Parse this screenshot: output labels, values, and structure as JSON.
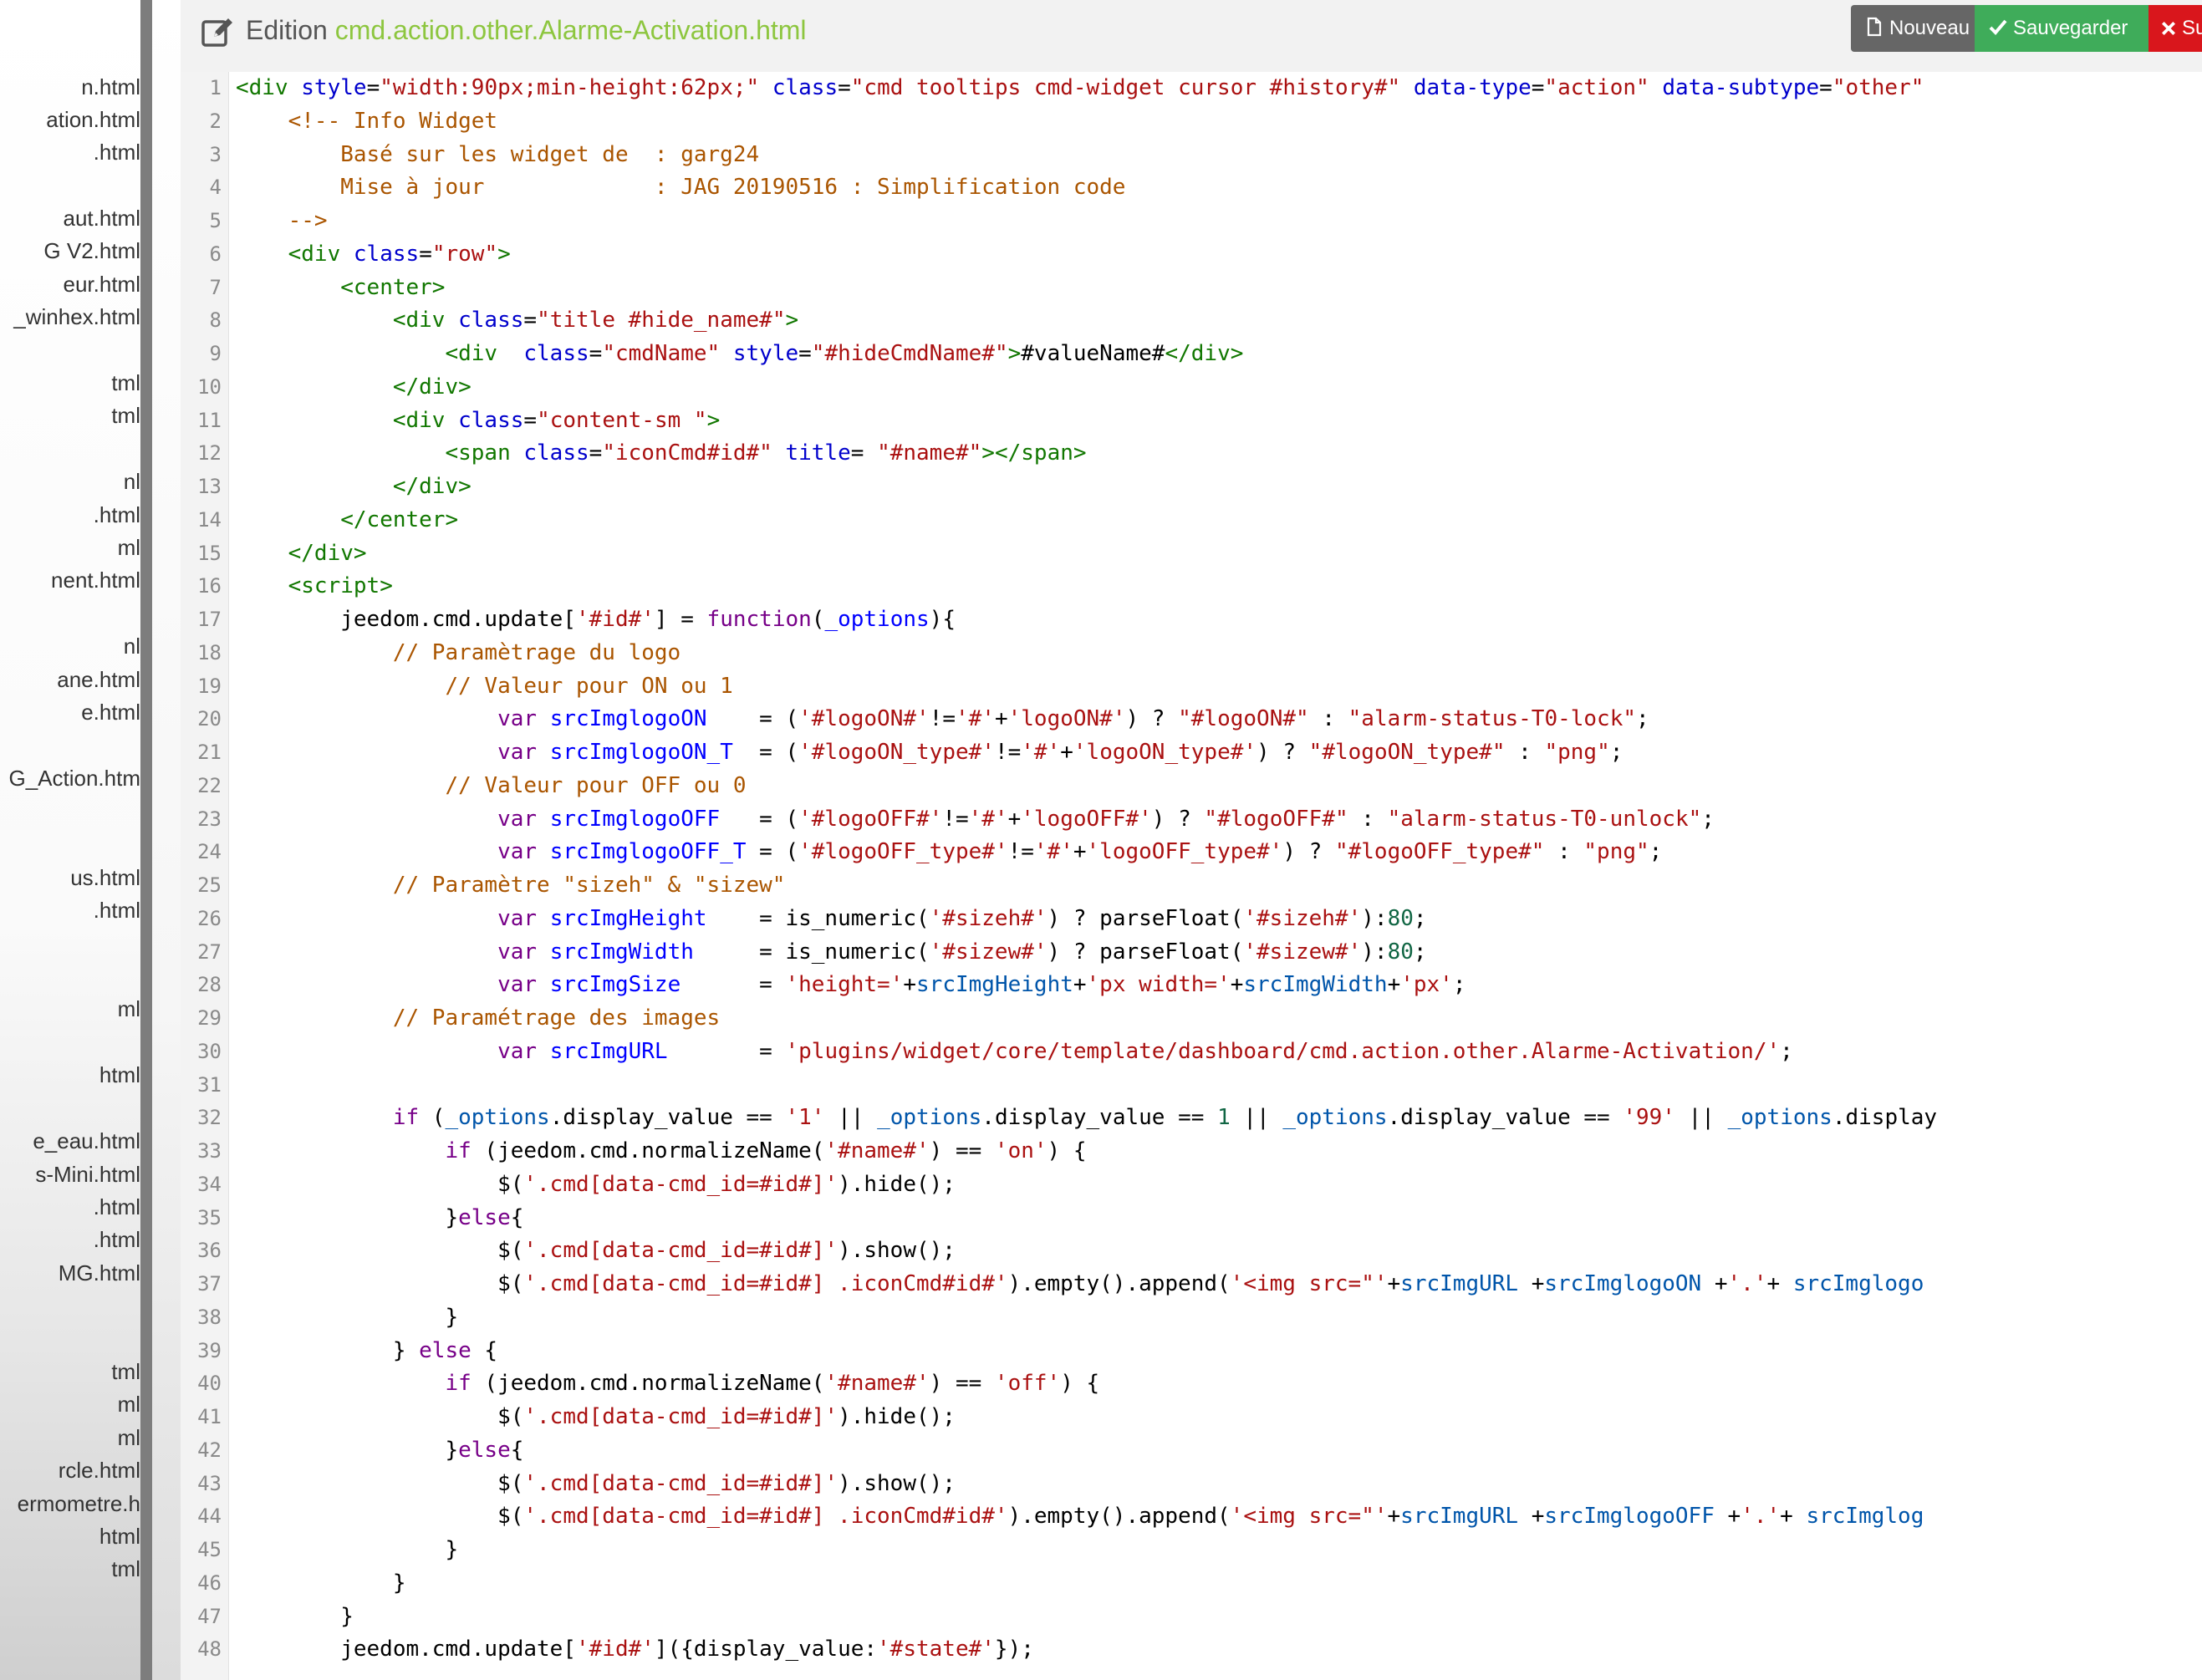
{
  "header": {
    "title_prefix": "Edition",
    "title_file": "cmd.action.other.Alarme-Activation.html",
    "buttons": {
      "new_label": "Nouveau",
      "save_label": "Sauvegarder",
      "delete_label": "Sup"
    }
  },
  "file_list": [
    "n.html",
    "ation.html",
    ".html",
    "aut.html",
    "G V2.html",
    "eur.html",
    "_winhex.html",
    "tml",
    "tml",
    "nl",
    ".html",
    "ml",
    "nent.html",
    "nl",
    "ane.html",
    "e.html",
    "G_Action.htm",
    "us.html",
    ".html",
    "ml",
    "html",
    "e_eau.html",
    "s-Mini.html",
    ".html",
    ".html",
    "MG.html",
    "tml",
    "ml",
    "ml",
    "rcle.html",
    "ermometre.h",
    "html",
    "tml"
  ],
  "colors": {
    "accent_green": "#8dc63f",
    "btn_new": "#666666",
    "btn_save": "#3fac5a",
    "btn_delete": "#d9161c",
    "gutter_bg": "#f3f3f3",
    "scrollbar": "#7d7d7d"
  },
  "icons": {
    "edit": "edit-icon",
    "new": "file-icon",
    "save": "check-icon",
    "delete": "close-icon"
  },
  "editor": {
    "code_lines": [
      [
        [
          "t-tag",
          "<div "
        ],
        [
          "t-attr",
          "style"
        ],
        [
          "t-pun",
          "="
        ],
        [
          "t-str",
          "\"width:90px;min-height:62px;\""
        ],
        [
          "t-pun",
          " "
        ],
        [
          "t-attr",
          "class"
        ],
        [
          "t-pun",
          "="
        ],
        [
          "t-str",
          "\"cmd tooltips cmd-widget cursor #history#\""
        ],
        [
          "t-pun",
          " "
        ],
        [
          "t-attr",
          "data-type"
        ],
        [
          "t-pun",
          "="
        ],
        [
          "t-str",
          "\"action\""
        ],
        [
          "t-pun",
          " "
        ],
        [
          "t-attr",
          "data-subtype"
        ],
        [
          "t-pun",
          "="
        ],
        [
          "t-str",
          "\"other\""
        ]
      ],
      [
        [
          "t-com",
          "    <!-- Info Widget"
        ]
      ],
      [
        [
          "t-com",
          "        Basé sur les widget de  : garg24"
        ]
      ],
      [
        [
          "t-com",
          "        Mise à jour             : JAG 20190516 : Simplification code"
        ]
      ],
      [
        [
          "t-com",
          "    -->"
        ]
      ],
      [
        [
          "t-pun",
          "    "
        ],
        [
          "t-tag",
          "<div "
        ],
        [
          "t-attr",
          "class"
        ],
        [
          "t-pun",
          "="
        ],
        [
          "t-str",
          "\"row\""
        ],
        [
          "t-tag",
          ">"
        ]
      ],
      [
        [
          "t-pun",
          "        "
        ],
        [
          "t-tag",
          "<center>"
        ]
      ],
      [
        [
          "t-pun",
          "            "
        ],
        [
          "t-tag",
          "<div "
        ],
        [
          "t-attr",
          "class"
        ],
        [
          "t-pun",
          "="
        ],
        [
          "t-str",
          "\"title #hide_name#\""
        ],
        [
          "t-tag",
          ">"
        ]
      ],
      [
        [
          "t-pun",
          "                "
        ],
        [
          "t-tag",
          "<div  "
        ],
        [
          "t-attr",
          "class"
        ],
        [
          "t-pun",
          "="
        ],
        [
          "t-str",
          "\"cmdName\""
        ],
        [
          "t-pun",
          " "
        ],
        [
          "t-attr",
          "style"
        ],
        [
          "t-pun",
          "="
        ],
        [
          "t-str",
          "\"#hideCmdName#\""
        ],
        [
          "t-tag",
          ">"
        ],
        [
          "t-pun",
          "#valueName#"
        ],
        [
          "t-tag",
          "</div>"
        ]
      ],
      [
        [
          "t-pun",
          "            "
        ],
        [
          "t-tag",
          "</div>"
        ]
      ],
      [
        [
          "t-pun",
          "            "
        ],
        [
          "t-tag",
          "<div "
        ],
        [
          "t-attr",
          "class"
        ],
        [
          "t-pun",
          "="
        ],
        [
          "t-str",
          "\"content-sm \""
        ],
        [
          "t-tag",
          ">"
        ]
      ],
      [
        [
          "t-pun",
          "                "
        ],
        [
          "t-tag",
          "<span "
        ],
        [
          "t-attr",
          "class"
        ],
        [
          "t-pun",
          "="
        ],
        [
          "t-str",
          "\"iconCmd#id#\""
        ],
        [
          "t-pun",
          " "
        ],
        [
          "t-attr",
          "title"
        ],
        [
          "t-pun",
          "= "
        ],
        [
          "t-str",
          "\"#name#\""
        ],
        [
          "t-tag",
          "></span>"
        ]
      ],
      [
        [
          "t-pun",
          "            "
        ],
        [
          "t-tag",
          "</div>"
        ]
      ],
      [
        [
          "t-pun",
          "        "
        ],
        [
          "t-tag",
          "</center>"
        ]
      ],
      [
        [
          "t-pun",
          "    "
        ],
        [
          "t-tag",
          "</div>"
        ]
      ],
      [
        [
          "t-pun",
          "    "
        ],
        [
          "t-tag",
          "<script>"
        ]
      ],
      [
        [
          "t-pun",
          "        jeedom.cmd.update["
        ],
        [
          "t-str",
          "'#id#'"
        ],
        [
          "t-pun",
          "] = "
        ],
        [
          "t-kw",
          "function"
        ],
        [
          "t-pun",
          "("
        ],
        [
          "t-def",
          "_options"
        ],
        [
          "t-pun",
          "){"
        ]
      ],
      [
        [
          "t-com",
          "            // Paramètrage du logo"
        ]
      ],
      [
        [
          "t-com",
          "                // Valeur pour ON ou 1"
        ]
      ],
      [
        [
          "t-pun",
          "                    "
        ],
        [
          "t-kw",
          "var"
        ],
        [
          "t-pun",
          " "
        ],
        [
          "t-def",
          "srcImglogoON"
        ],
        [
          "t-pun",
          "    = ("
        ],
        [
          "t-str",
          "'#logoON#'"
        ],
        [
          "t-pun",
          "!="
        ],
        [
          "t-str",
          "'#'"
        ],
        [
          "t-pun",
          "+"
        ],
        [
          "t-str",
          "'logoON#'"
        ],
        [
          "t-pun",
          ") ? "
        ],
        [
          "t-str",
          "\"#logoON#\""
        ],
        [
          "t-pun",
          " : "
        ],
        [
          "t-str",
          "\"alarm-status-T0-lock\""
        ],
        [
          "t-pun",
          ";"
        ]
      ],
      [
        [
          "t-pun",
          "                    "
        ],
        [
          "t-kw",
          "var"
        ],
        [
          "t-pun",
          " "
        ],
        [
          "t-def",
          "srcImglogoON_T"
        ],
        [
          "t-pun",
          "  = ("
        ],
        [
          "t-str",
          "'#logoON_type#'"
        ],
        [
          "t-pun",
          "!="
        ],
        [
          "t-str",
          "'#'"
        ],
        [
          "t-pun",
          "+"
        ],
        [
          "t-str",
          "'logoON_type#'"
        ],
        [
          "t-pun",
          ") ? "
        ],
        [
          "t-str",
          "\"#logoON_type#\""
        ],
        [
          "t-pun",
          " : "
        ],
        [
          "t-str",
          "\"png\""
        ],
        [
          "t-pun",
          ";"
        ]
      ],
      [
        [
          "t-com",
          "                // Valeur pour OFF ou 0"
        ]
      ],
      [
        [
          "t-pun",
          "                    "
        ],
        [
          "t-kw",
          "var"
        ],
        [
          "t-pun",
          " "
        ],
        [
          "t-def",
          "srcImglogoOFF"
        ],
        [
          "t-pun",
          "   = ("
        ],
        [
          "t-str",
          "'#logoOFF#'"
        ],
        [
          "t-pun",
          "!="
        ],
        [
          "t-str",
          "'#'"
        ],
        [
          "t-pun",
          "+"
        ],
        [
          "t-str",
          "'logoOFF#'"
        ],
        [
          "t-pun",
          ") ? "
        ],
        [
          "t-str",
          "\"#logoOFF#\""
        ],
        [
          "t-pun",
          " : "
        ],
        [
          "t-str",
          "\"alarm-status-T0-unlock\""
        ],
        [
          "t-pun",
          ";"
        ]
      ],
      [
        [
          "t-pun",
          "                    "
        ],
        [
          "t-kw",
          "var"
        ],
        [
          "t-pun",
          " "
        ],
        [
          "t-def",
          "srcImglogoOFF_T"
        ],
        [
          "t-pun",
          " = ("
        ],
        [
          "t-str",
          "'#logoOFF_type#'"
        ],
        [
          "t-pun",
          "!="
        ],
        [
          "t-str",
          "'#'"
        ],
        [
          "t-pun",
          "+"
        ],
        [
          "t-str",
          "'logoOFF_type#'"
        ],
        [
          "t-pun",
          ") ? "
        ],
        [
          "t-str",
          "\"#logoOFF_type#\""
        ],
        [
          "t-pun",
          " : "
        ],
        [
          "t-str",
          "\"png\""
        ],
        [
          "t-pun",
          ";"
        ]
      ],
      [
        [
          "t-com",
          "            // Paramètre \"sizeh\" & \"sizew\""
        ]
      ],
      [
        [
          "t-pun",
          "                    "
        ],
        [
          "t-kw",
          "var"
        ],
        [
          "t-pun",
          " "
        ],
        [
          "t-def",
          "srcImgHeight"
        ],
        [
          "t-pun",
          "    = is_numeric("
        ],
        [
          "t-str",
          "'#sizeh#'"
        ],
        [
          "t-pun",
          ") ? parseFloat("
        ],
        [
          "t-str",
          "'#sizeh#'"
        ],
        [
          "t-pun",
          "):"
        ],
        [
          "t-num",
          "80"
        ],
        [
          "t-pun",
          ";"
        ]
      ],
      [
        [
          "t-pun",
          "                    "
        ],
        [
          "t-kw",
          "var"
        ],
        [
          "t-pun",
          " "
        ],
        [
          "t-def",
          "srcImgWidth"
        ],
        [
          "t-pun",
          "     = is_numeric("
        ],
        [
          "t-str",
          "'#sizew#'"
        ],
        [
          "t-pun",
          ") ? parseFloat("
        ],
        [
          "t-str",
          "'#sizew#'"
        ],
        [
          "t-pun",
          "):"
        ],
        [
          "t-num",
          "80"
        ],
        [
          "t-pun",
          ";"
        ]
      ],
      [
        [
          "t-pun",
          "                    "
        ],
        [
          "t-kw",
          "var"
        ],
        [
          "t-pun",
          " "
        ],
        [
          "t-def",
          "srcImgSize"
        ],
        [
          "t-pun",
          "      = "
        ],
        [
          "t-str",
          "'height='"
        ],
        [
          "t-pun",
          "+"
        ],
        [
          "t-var",
          "srcImgHeight"
        ],
        [
          "t-pun",
          "+"
        ],
        [
          "t-str",
          "'px width='"
        ],
        [
          "t-pun",
          "+"
        ],
        [
          "t-var",
          "srcImgWidth"
        ],
        [
          "t-pun",
          "+"
        ],
        [
          "t-str",
          "'px'"
        ],
        [
          "t-pun",
          ";"
        ]
      ],
      [
        [
          "t-com",
          "            // Paramétrage des images"
        ]
      ],
      [
        [
          "t-pun",
          "                    "
        ],
        [
          "t-kw",
          "var"
        ],
        [
          "t-pun",
          " "
        ],
        [
          "t-def",
          "srcImgURL"
        ],
        [
          "t-pun",
          "       = "
        ],
        [
          "t-str",
          "'plugins/widget/core/template/dashboard/cmd.action.other.Alarme-Activation/'"
        ],
        [
          "t-pun",
          ";"
        ]
      ],
      [
        [
          "t-pun",
          ""
        ]
      ],
      [
        [
          "t-pun",
          "            "
        ],
        [
          "t-kw",
          "if"
        ],
        [
          "t-pun",
          " ("
        ],
        [
          "t-var",
          "_options"
        ],
        [
          "t-pun",
          ".display_value == "
        ],
        [
          "t-str",
          "'1'"
        ],
        [
          "t-pun",
          " || "
        ],
        [
          "t-var",
          "_options"
        ],
        [
          "t-pun",
          ".display_value == "
        ],
        [
          "t-num",
          "1"
        ],
        [
          "t-pun",
          " || "
        ],
        [
          "t-var",
          "_options"
        ],
        [
          "t-pun",
          ".display_value == "
        ],
        [
          "t-str",
          "'99'"
        ],
        [
          "t-pun",
          " || "
        ],
        [
          "t-var",
          "_options"
        ],
        [
          "t-pun",
          ".display"
        ]
      ],
      [
        [
          "t-pun",
          "                "
        ],
        [
          "t-kw",
          "if"
        ],
        [
          "t-pun",
          " (jeedom.cmd.normalizeName("
        ],
        [
          "t-str",
          "'#name#'"
        ],
        [
          "t-pun",
          ") == "
        ],
        [
          "t-str",
          "'on'"
        ],
        [
          "t-pun",
          ") {"
        ]
      ],
      [
        [
          "t-pun",
          "                    $("
        ],
        [
          "t-str",
          "'.cmd[data-cmd_id=#id#]'"
        ],
        [
          "t-pun",
          ").hide();"
        ]
      ],
      [
        [
          "t-pun",
          "                }"
        ],
        [
          "t-kw",
          "else"
        ],
        [
          "t-pun",
          "{"
        ]
      ],
      [
        [
          "t-pun",
          "                    $("
        ],
        [
          "t-str",
          "'.cmd[data-cmd_id=#id#]'"
        ],
        [
          "t-pun",
          ").show();"
        ]
      ],
      [
        [
          "t-pun",
          "                    $("
        ],
        [
          "t-str",
          "'.cmd[data-cmd_id=#id#] .iconCmd#id#'"
        ],
        [
          "t-pun",
          ").empty().append("
        ],
        [
          "t-str",
          "'<img src=\"'"
        ],
        [
          "t-pun",
          "+"
        ],
        [
          "t-var",
          "srcImgURL"
        ],
        [
          "t-pun",
          " +"
        ],
        [
          "t-var",
          "srcImglogoON"
        ],
        [
          "t-pun",
          " +"
        ],
        [
          "t-str",
          "'.'"
        ],
        [
          "t-pun",
          "+ "
        ],
        [
          "t-var",
          "srcImglogo"
        ]
      ],
      [
        [
          "t-pun",
          "                }"
        ]
      ],
      [
        [
          "t-pun",
          "            } "
        ],
        [
          "t-kw",
          "else"
        ],
        [
          "t-pun",
          " {"
        ]
      ],
      [
        [
          "t-pun",
          "                "
        ],
        [
          "t-kw",
          "if"
        ],
        [
          "t-pun",
          " (jeedom.cmd.normalizeName("
        ],
        [
          "t-str",
          "'#name#'"
        ],
        [
          "t-pun",
          ") == "
        ],
        [
          "t-str",
          "'off'"
        ],
        [
          "t-pun",
          ") {"
        ]
      ],
      [
        [
          "t-pun",
          "                    $("
        ],
        [
          "t-str",
          "'.cmd[data-cmd_id=#id#]'"
        ],
        [
          "t-pun",
          ").hide();"
        ]
      ],
      [
        [
          "t-pun",
          "                }"
        ],
        [
          "t-kw",
          "else"
        ],
        [
          "t-pun",
          "{"
        ]
      ],
      [
        [
          "t-pun",
          "                    $("
        ],
        [
          "t-str",
          "'.cmd[data-cmd_id=#id#]'"
        ],
        [
          "t-pun",
          ").show();"
        ]
      ],
      [
        [
          "t-pun",
          "                    $("
        ],
        [
          "t-str",
          "'.cmd[data-cmd_id=#id#] .iconCmd#id#'"
        ],
        [
          "t-pun",
          ").empty().append("
        ],
        [
          "t-str",
          "'<img src=\"'"
        ],
        [
          "t-pun",
          "+"
        ],
        [
          "t-var",
          "srcImgURL"
        ],
        [
          "t-pun",
          " +"
        ],
        [
          "t-var",
          "srcImglogoOFF"
        ],
        [
          "t-pun",
          " +"
        ],
        [
          "t-str",
          "'.'"
        ],
        [
          "t-pun",
          "+ "
        ],
        [
          "t-var",
          "srcImglog"
        ]
      ],
      [
        [
          "t-pun",
          "                }"
        ]
      ],
      [
        [
          "t-pun",
          "            }"
        ]
      ],
      [
        [
          "t-pun",
          "        }"
        ]
      ],
      [
        [
          "t-pun",
          "        jeedom.cmd.update["
        ],
        [
          "t-str",
          "'#id#'"
        ],
        [
          "t-pun",
          "]({display_value:"
        ],
        [
          "t-str",
          "'#state#'"
        ],
        [
          "t-pun",
          "});"
        ]
      ]
    ]
  }
}
